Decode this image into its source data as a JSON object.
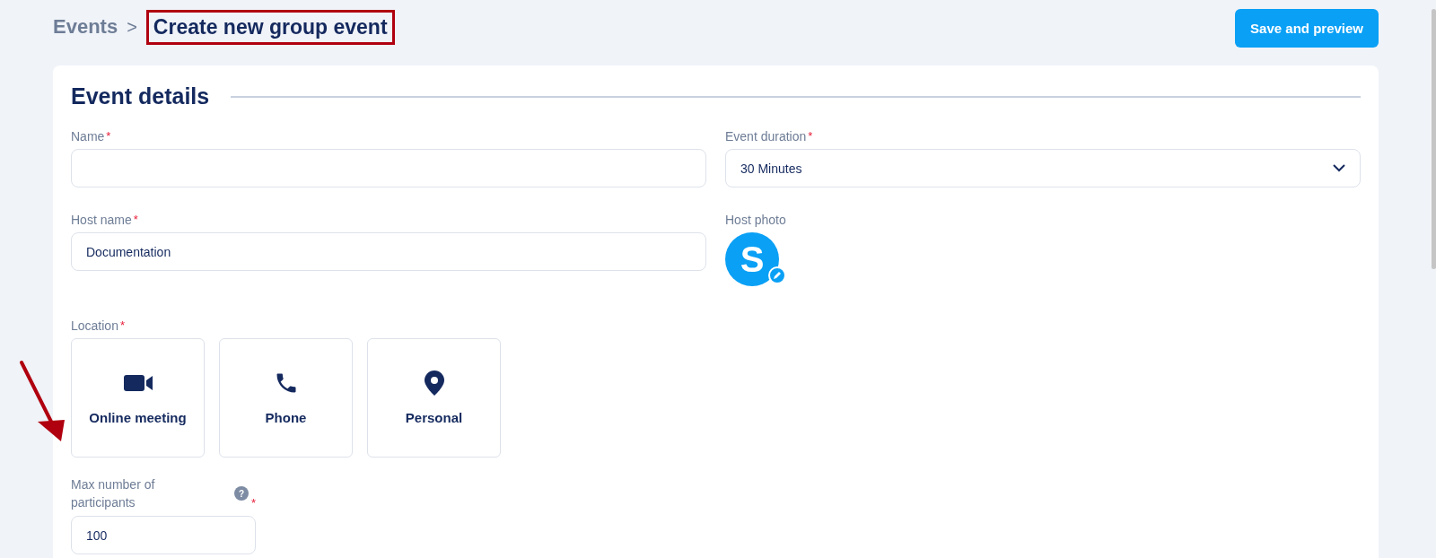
{
  "breadcrumb": {
    "parent": "Events",
    "separator": ">",
    "current": "Create new group event",
    "highlighted": true
  },
  "save_button": "Save and preview",
  "section": {
    "title": "Event details"
  },
  "required_mark": "*",
  "name_field": {
    "label": "Name",
    "required": true
  },
  "duration_field": {
    "label": "Event duration",
    "required": true,
    "value": "30 Minutes"
  },
  "host_name_field": {
    "label": "Host name",
    "required": true,
    "value": "Documentation"
  },
  "host_photo": {
    "label": "Host photo",
    "initial": "S"
  },
  "location": {
    "label": "Location",
    "required": true,
    "options": [
      {
        "kind": "video",
        "label": "Online meeting",
        "selected": false
      },
      {
        "kind": "phone",
        "label": "Phone",
        "selected": false
      },
      {
        "kind": "pin",
        "label": "Personal",
        "selected": false
      }
    ]
  },
  "participants_field": {
    "label": "Max number of participants",
    "required": true,
    "help": "?",
    "value": "100"
  },
  "annotation_arrow": true
}
